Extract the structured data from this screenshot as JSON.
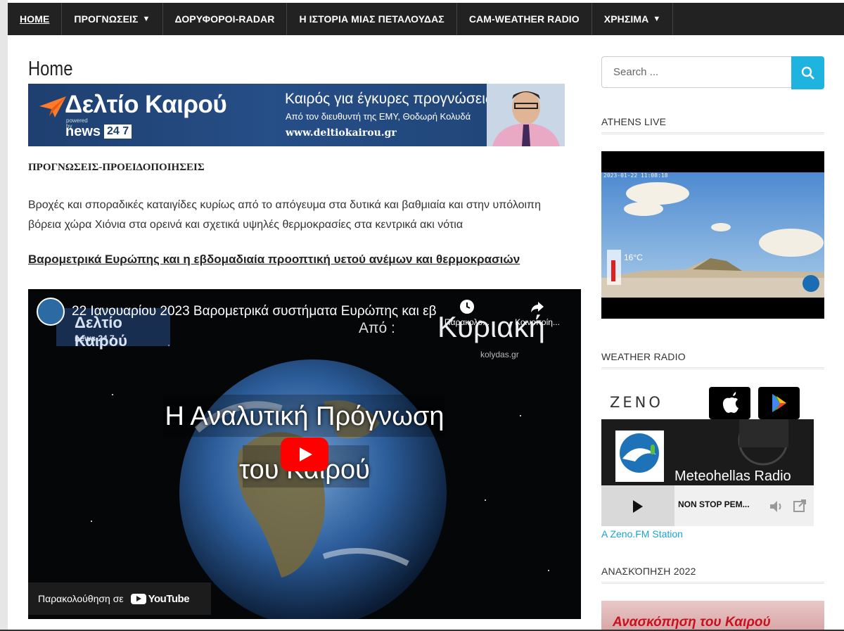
{
  "nav": {
    "items": [
      {
        "label": "HOME",
        "dropdown": false,
        "active": true
      },
      {
        "label": "ΠΡΟΓΝΩΣΕΙΣ",
        "dropdown": true,
        "active": false
      },
      {
        "label": "ΔΟΡΥΦΟΡΟΙ-RADAR",
        "dropdown": false,
        "active": false
      },
      {
        "label": "Η ΙΣΤΟΡΙΑ ΜΙΑΣ ΠΕΤΑΛΟΥΔΑΣ",
        "dropdown": false,
        "active": false
      },
      {
        "label": "CAM-WEATHER RADIO",
        "dropdown": false,
        "active": false
      },
      {
        "label": "ΧΡΗΣΙΜΑ",
        "dropdown": true,
        "active": false
      }
    ]
  },
  "main": {
    "page_title": "Home",
    "banner": {
      "brand": "Δελτίο Καιρού",
      "powered": "powered by",
      "news": "news",
      "news247": "24 7",
      "tagline": "Καιρός για έγκυρες προγνώσεις",
      "subline": "Από τον διευθυντή της ΕΜΥ, Θοδωρή Κολυδά",
      "site": "www.deltiokairou.gr"
    },
    "section_heading": "ΠΡΟΓΝΩΣΕΙΣ-ΠΡΟΕΙΔΟΠΟΙΗΣΕΙΣ",
    "paragraph": "Βροχές και σποραδικές καταιγίδες κυρίως από το απόγευμα στα δυτικά και βαθμιαία και στην υπόλοιπη βόρεια χώρα Χιόνια στα ορεινά και σχετικά υψηλές θερμοκρασίες στα κεντρικά ακι νότια",
    "article_link": "Βαρομετρικά Ευρώπης και η εβδομαδιαία προοπτική υετού ανέμων και θερμοκρασιών",
    "video": {
      "title": "22 Ιανουαρίου 2023 Βαρομετρικά συστήματα Ευρώπης και εβ...",
      "watch_later": "Παρακολο...",
      "share": "Κοινοποίη...",
      "overlay_brand": "Δελτίο Καιρού",
      "overlay_news": "news 24 7",
      "apo": "Από :",
      "kyriaki": "Κυριακή",
      "kolydas": "kolydas.gr",
      "big_title_1": "Η Αναλυτική Πρόγνωση",
      "big_title_2": "του Καιρού",
      "watch_on": "Παρακολούθηση σε",
      "youtube": "YouTube"
    }
  },
  "sidebar": {
    "search_placeholder": "Search ...",
    "athens_live": {
      "title": "ATHENS LIVE",
      "timestamp": "2023-01-22 11:08:18",
      "temp": "16°C"
    },
    "weather_radio": {
      "title": "WEATHER RADIO",
      "zeno": "ZENO",
      "station": "Meteohellas Radio",
      "now_playing": "NON STOP ΡΕΜ...",
      "link": "A Zeno.FM Station"
    },
    "review": {
      "title": "ΑΝΑΣΚΌΠΗΣΗ 2022",
      "thumb_text": "Ανασκόπηση του Καιρού"
    }
  },
  "colors": {
    "nav_bg": "#222222",
    "accent": "#1fb3df",
    "link": "#1aa3d9",
    "youtube_red": "#ff0000"
  }
}
